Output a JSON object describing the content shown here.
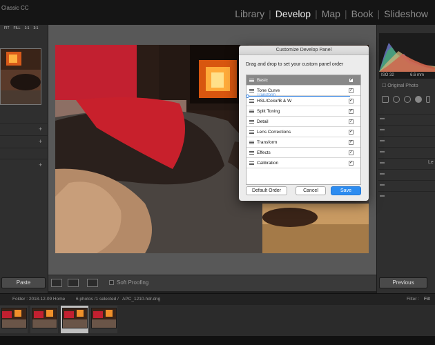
{
  "app": {
    "brand": "Classic CC"
  },
  "modules": [
    "Library",
    "Develop",
    "Map",
    "Book",
    "Slideshow"
  ],
  "active_module": "Develop",
  "navigator": {
    "tabs": [
      "FIT",
      "FILL",
      "1:1",
      "3:1"
    ]
  },
  "toolbar": {
    "paste_label": "Paste",
    "soft_proofing_label": "Soft Proofing",
    "previous_label": "Previous"
  },
  "histogram": {
    "iso": "ISO 32",
    "focal": "6.6 mm",
    "original_label": "Original Photo"
  },
  "right_panel": {
    "partial_label": "Le"
  },
  "filmbar": {
    "folder": "Folder : 2018-12-09 Home",
    "selection": "6 photos /1 selected /",
    "filename": "APC_1210-hdr.dng",
    "filter_label": "Filter :",
    "filter_value": "Filt"
  },
  "dialog": {
    "title": "Customize Develop Panel",
    "instruction": "Drag and drop to set your custom panel order",
    "drag_ghost": "Transform",
    "panels": [
      {
        "label": "Basic",
        "checked": true
      },
      {
        "label": "Tone Curve",
        "checked": true
      },
      {
        "label": "HSL/Color/B & W",
        "checked": true
      },
      {
        "label": "Split Toning",
        "checked": true
      },
      {
        "label": "Detail",
        "checked": true
      },
      {
        "label": "Lens Corrections",
        "checked": true
      },
      {
        "label": "Transform",
        "checked": true
      },
      {
        "label": "Effects",
        "checked": true
      },
      {
        "label": "Calibration",
        "checked": true
      }
    ],
    "check_mark": "✓",
    "default_order_label": "Default Order",
    "cancel_label": "Cancel",
    "save_label": "Save"
  },
  "colors": {
    "accent": "#2d8cf0",
    "selected_row": "#888888",
    "background": "#1f1f1f"
  }
}
